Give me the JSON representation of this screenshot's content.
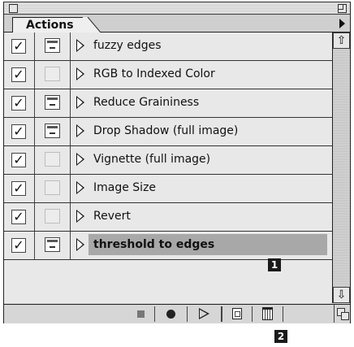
{
  "panel": {
    "tab_label": "Actions",
    "menu_icon": "triangle-right-icon"
  },
  "actions": [
    {
      "label": "fuzzy edges",
      "checked": true,
      "dialog": true
    },
    {
      "label": "RGB to Indexed Color",
      "checked": true,
      "dialog": false
    },
    {
      "label": "Reduce Graininess",
      "checked": true,
      "dialog": true
    },
    {
      "label": "Drop Shadow (full image)",
      "checked": true,
      "dialog": true
    },
    {
      "label": "Vignette (full image)",
      "checked": true,
      "dialog": false
    },
    {
      "label": "Image Size",
      "checked": true,
      "dialog": false
    },
    {
      "label": "Revert",
      "checked": true,
      "dialog": false
    },
    {
      "label": "threshold to edges",
      "checked": true,
      "dialog": true,
      "selected": true
    }
  ],
  "check_glyph": "✓",
  "scroll": {
    "up_glyph": "⇧",
    "down_glyph": "⇩"
  },
  "toolbar": {
    "buttons": [
      "stop-icon",
      "record-icon",
      "play-icon",
      "new-action-icon",
      "trash-icon"
    ]
  },
  "callouts": {
    "selected_row": "1",
    "new_action_button": "2"
  },
  "colors": {
    "selected_highlight": "#a8a8a8",
    "panel_bg": "#d6d6d6"
  }
}
